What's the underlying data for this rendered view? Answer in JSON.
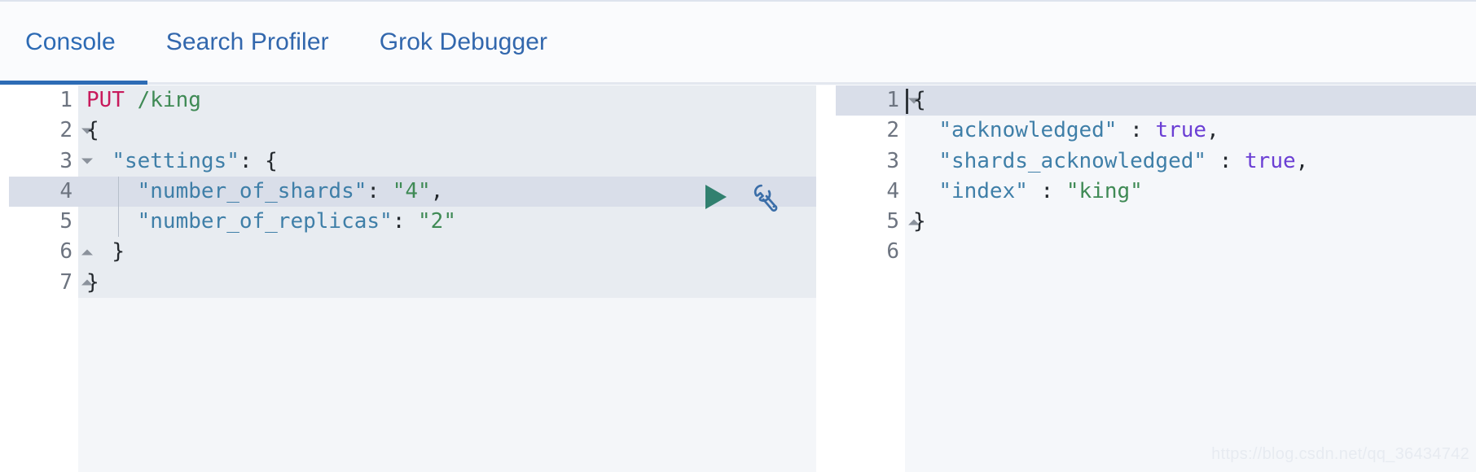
{
  "tabs": [
    {
      "label": "Console",
      "active": true
    },
    {
      "label": "Search Profiler",
      "active": false
    },
    {
      "label": "Grok Debugger",
      "active": false
    }
  ],
  "actions": {
    "run_label": "▶",
    "run_name": "play-icon",
    "wrench_name": "wrench-icon"
  },
  "colors": {
    "accent": "#2d6cb5",
    "tab_text": "#3267ad",
    "method": "#c81a5c",
    "string": "#3f8a55",
    "key": "#3f7fa8",
    "boolean": "#6b3fd4",
    "play": "#31806f",
    "wrench": "#3b6ea8",
    "editor_bg": "#e8ecf1",
    "highlight": "#d9dee9",
    "response_bg": "#f5f7fa",
    "response_highlight": "#dfe3eb"
  },
  "request_editor": {
    "lines": [
      {
        "num": "1",
        "fold": "",
        "highlight": false,
        "indent_guide": false,
        "tokens": [
          {
            "t": "PUT",
            "c": "tk-method"
          },
          {
            "t": " ",
            "c": "tk-punct"
          },
          {
            "t": "/king",
            "c": "tk-url"
          }
        ]
      },
      {
        "num": "2",
        "fold": "down",
        "highlight": false,
        "indent_guide": false,
        "tokens": [
          {
            "t": "{",
            "c": "tk-brace"
          }
        ]
      },
      {
        "num": "3",
        "fold": "down",
        "highlight": false,
        "indent_guide": false,
        "tokens": [
          {
            "t": "  ",
            "c": "tk-punct"
          },
          {
            "t": "\"settings\"",
            "c": "tk-key"
          },
          {
            "t": ": ",
            "c": "tk-punct"
          },
          {
            "t": "{",
            "c": "tk-brace"
          }
        ]
      },
      {
        "num": "4",
        "fold": "",
        "highlight": true,
        "indent_guide": true,
        "tokens": [
          {
            "t": "    ",
            "c": "tk-punct"
          },
          {
            "t": "\"number_of_shards\"",
            "c": "tk-key"
          },
          {
            "t": ": ",
            "c": "tk-punct"
          },
          {
            "t": "\"4\"",
            "c": "tk-str"
          },
          {
            "t": ",",
            "c": "tk-punct"
          }
        ]
      },
      {
        "num": "5",
        "fold": "",
        "highlight": false,
        "indent_guide": true,
        "tokens": [
          {
            "t": "    ",
            "c": "tk-punct"
          },
          {
            "t": "\"number_of_replicas\"",
            "c": "tk-key"
          },
          {
            "t": ": ",
            "c": "tk-punct"
          },
          {
            "t": "\"2\"",
            "c": "tk-str"
          }
        ]
      },
      {
        "num": "6",
        "fold": "up",
        "highlight": false,
        "indent_guide": false,
        "tokens": [
          {
            "t": "  ",
            "c": "tk-punct"
          },
          {
            "t": "}",
            "c": "tk-brace"
          }
        ]
      },
      {
        "num": "7",
        "fold": "up",
        "highlight": false,
        "indent_guide": false,
        "tokens": [
          {
            "t": "}",
            "c": "tk-brace"
          }
        ]
      }
    ],
    "plain_text": "PUT /king\n{\n  \"settings\": {\n    \"number_of_shards\": \"4\",\n    \"number_of_replicas\": \"2\"\n  }\n}"
  },
  "response_editor": {
    "lines": [
      {
        "num": "1",
        "fold": "down",
        "highlight": true,
        "tokens": [
          {
            "t": "{",
            "c": "tk-brace"
          }
        ]
      },
      {
        "num": "2",
        "fold": "",
        "highlight": false,
        "tokens": [
          {
            "t": "  ",
            "c": "tk-punct"
          },
          {
            "t": "\"acknowledged\"",
            "c": "tk-key"
          },
          {
            "t": " : ",
            "c": "tk-punct"
          },
          {
            "t": "true",
            "c": "tk-bool"
          },
          {
            "t": ",",
            "c": "tk-punct"
          }
        ]
      },
      {
        "num": "3",
        "fold": "",
        "highlight": false,
        "tokens": [
          {
            "t": "  ",
            "c": "tk-punct"
          },
          {
            "t": "\"shards_acknowledged\"",
            "c": "tk-key"
          },
          {
            "t": " : ",
            "c": "tk-punct"
          },
          {
            "t": "true",
            "c": "tk-bool"
          },
          {
            "t": ",",
            "c": "tk-punct"
          }
        ]
      },
      {
        "num": "4",
        "fold": "",
        "highlight": false,
        "tokens": [
          {
            "t": "  ",
            "c": "tk-punct"
          },
          {
            "t": "\"index\"",
            "c": "tk-key"
          },
          {
            "t": " : ",
            "c": "tk-punct"
          },
          {
            "t": "\"king\"",
            "c": "tk-str"
          }
        ]
      },
      {
        "num": "5",
        "fold": "up",
        "highlight": false,
        "tokens": [
          {
            "t": "}",
            "c": "tk-brace"
          }
        ]
      },
      {
        "num": "6",
        "fold": "",
        "highlight": false,
        "tokens": []
      }
    ],
    "plain_text": "{\n  \"acknowledged\" : true,\n  \"shards_acknowledged\" : true,\n  \"index\" : \"king\"\n}"
  },
  "watermark": {
    "text": "https://blog.csdn.net/qq_36434742"
  }
}
